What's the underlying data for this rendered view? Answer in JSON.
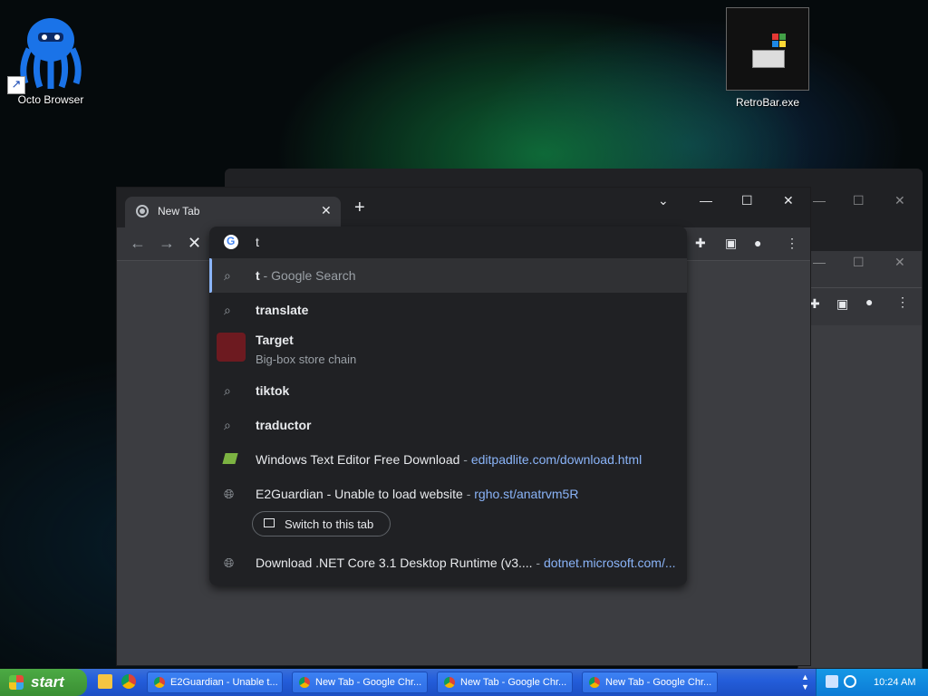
{
  "desktop": {
    "icons": [
      {
        "label": "Octo Browser"
      },
      {
        "label": "RetroBar.exe"
      }
    ]
  },
  "chrome": {
    "tab_title": "New Tab",
    "omnibox_text": "t",
    "suggestions": [
      {
        "bold": "t",
        "rest": " - Google Search",
        "url": ""
      },
      {
        "bold": "translate",
        "rest": "",
        "url": ""
      },
      {
        "bold": "Target",
        "rest": "",
        "sub": "Big-box store chain"
      },
      {
        "bold": "tiktok",
        "rest": "",
        "url": ""
      },
      {
        "bold": "traductor",
        "rest": "",
        "url": ""
      },
      {
        "main": "Windows Text Editor Free Download",
        "url": "editpadlite.com/download.html"
      },
      {
        "main": "E2Guardian - Unable to load website",
        "url": "rgho.st/anatrvm5R"
      },
      {
        "main": "Download .NET Core 3.1 Desktop Runtime (v3....",
        "url": "dotnet.microsoft.com/..."
      }
    ],
    "switch_tab_label": "Switch to this tab"
  },
  "taskbar": {
    "start_label": "start",
    "buttons": [
      {
        "label": "E2Guardian - Unable t..."
      },
      {
        "label": "New Tab - Google Chr..."
      },
      {
        "label": "New Tab - Google Chr..."
      },
      {
        "label": "New Tab - Google Chr..."
      }
    ],
    "clock": "10:24 AM"
  },
  "colors": {
    "accent": "#8ab4f8",
    "omni_bg": "#202124",
    "taskbar": "#245edb",
    "start": "#3a8f33"
  }
}
